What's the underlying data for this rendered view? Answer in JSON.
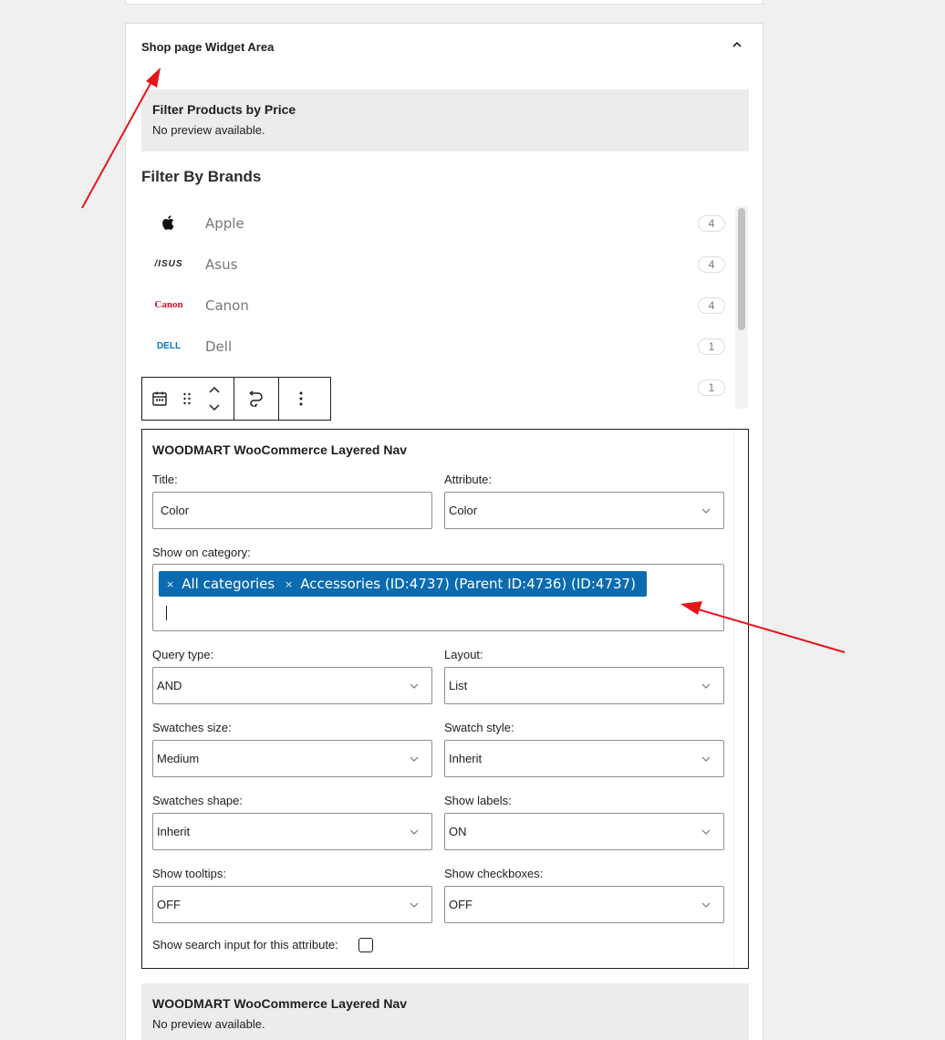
{
  "panel": {
    "title": "Shop page Widget Area",
    "placeholder_price": {
      "title": "Filter Products by Price",
      "text": "No preview available."
    },
    "placeholder_nav": {
      "title": "WOODMART WooCommerce Layered Nav",
      "text": "No preview available."
    }
  },
  "brands": {
    "heading": "Filter By Brands",
    "items": [
      {
        "name": "Apple",
        "count": "4",
        "logo": ""
      },
      {
        "name": "Asus",
        "count": "4",
        "logo": "/ISUS"
      },
      {
        "name": "Canon",
        "count": "4",
        "logo": "Canon"
      },
      {
        "name": "Dell",
        "count": "1",
        "logo": "DELL"
      },
      {
        "name": "",
        "count": "1",
        "logo": ""
      }
    ]
  },
  "toolbar": {
    "icons": [
      "calendar-icon",
      "drag-handle-icon",
      "move-up-down-icon",
      "transform-icon",
      "more-options-icon"
    ]
  },
  "widget": {
    "title": "WOODMART WooCommerce Layered Nav",
    "title_label": "Title:",
    "title_value": "Color",
    "attribute_label": "Attribute:",
    "attribute_value": "Color",
    "category_label": "Show on category:",
    "category_tags": [
      "All categories",
      "Accessories (ID:4737) (Parent ID:4736) (ID:4737)"
    ],
    "query_type_label": "Query type:",
    "query_type_value": "AND",
    "layout_label": "Layout:",
    "layout_value": "List",
    "swatches_size_label": "Swatches size:",
    "swatches_size_value": "Medium",
    "swatch_style_label": "Swatch style:",
    "swatch_style_value": "Inherit",
    "swatches_shape_label": "Swatches shape:",
    "swatches_shape_value": "Inherit",
    "show_labels_label": "Show labels:",
    "show_labels_value": "ON",
    "show_tooltips_label": "Show tooltips:",
    "show_tooltips_value": "OFF",
    "show_checkboxes_label": "Show checkboxes:",
    "show_checkboxes_value": "OFF",
    "search_input_label": "Show search input for this attribute:"
  },
  "colors": {
    "accent": "#0a6bb1",
    "arrow": "#e8141b",
    "placeholder_bg": "#ececec"
  }
}
